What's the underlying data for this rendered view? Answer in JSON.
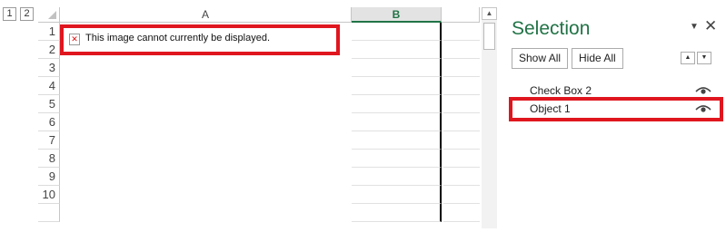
{
  "sheet": {
    "outline_levels": [
      "1",
      "2"
    ],
    "columns": [
      "A",
      "B"
    ],
    "rows": [
      "1",
      "2",
      "3",
      "4",
      "5",
      "6",
      "7",
      "8",
      "9",
      "10"
    ],
    "broken_image_text": "This image cannot currently be displayed."
  },
  "selection_pane": {
    "title": "Selection",
    "show_all_label": "Show All",
    "hide_all_label": "Hide All",
    "items": [
      {
        "name": "Check Box 2",
        "icon": "eye-icon",
        "selected": false
      },
      {
        "name": "Object 1",
        "icon": "eye-icon",
        "selected": true
      }
    ]
  },
  "colors": {
    "accent": "#217346",
    "highlight": "#e0161f"
  }
}
